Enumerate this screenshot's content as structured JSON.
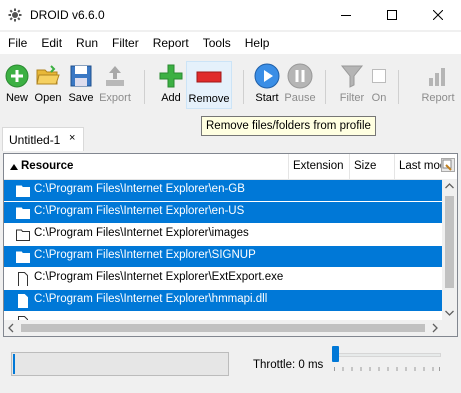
{
  "window": {
    "title": "DROID v6.6.0",
    "controls": [
      "minimize",
      "maximize",
      "close"
    ]
  },
  "menu": [
    "File",
    "Edit",
    "Run",
    "Filter",
    "Report",
    "Tools",
    "Help"
  ],
  "toolbar": {
    "new": "New",
    "open": "Open",
    "save": "Save",
    "export": "Export",
    "add": "Add",
    "remove": "Remove",
    "start": "Start",
    "pause": "Pause",
    "filter": "Filter",
    "on": "On",
    "report": "Report"
  },
  "tooltip": "Remove files/folders from profile",
  "tab": {
    "label": "Untitled-1",
    "close": "×"
  },
  "table": {
    "columns": [
      "Resource",
      "Extension",
      "Size",
      "Last mod"
    ],
    "rows": [
      {
        "path": "C:\\Program Files\\Internet Explorer\\en-GB",
        "type": "folder",
        "selected": true
      },
      {
        "path": "C:\\Program Files\\Internet Explorer\\en-US",
        "type": "folder",
        "selected": true
      },
      {
        "path": "C:\\Program Files\\Internet Explorer\\images",
        "type": "folder",
        "selected": false
      },
      {
        "path": "C:\\Program Files\\Internet Explorer\\SIGNUP",
        "type": "folder",
        "selected": true
      },
      {
        "path": "C:\\Program Files\\Internet Explorer\\ExtExport.exe",
        "type": "file",
        "selected": false
      },
      {
        "path": "C:\\Program Files\\Internet Explorer\\hmmapi.dll",
        "type": "file",
        "selected": true
      }
    ]
  },
  "status": {
    "throttle": "Throttle: 0 ms"
  },
  "colors": {
    "selection": "#0078d7",
    "accent": "#0078d7"
  }
}
